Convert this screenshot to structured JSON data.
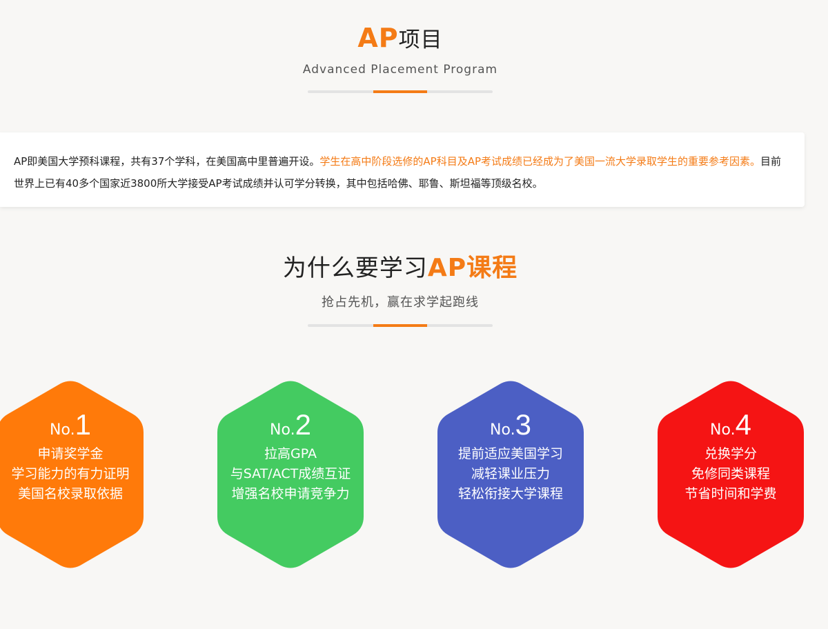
{
  "section1": {
    "title_accent": "AP",
    "title_rest": "项目",
    "subtitle": "Advanced Placement Program"
  },
  "intro": {
    "text_part1": "AP即美国大学预科课程，共有37个学科，在美国高中里普遍开设。",
    "text_highlight": "学生在高中阶段选修的AP科目及AP考试成绩已经成为了美国一流大学录取学生的重要参考因素。",
    "text_part2": "目前世界上已有40多个国家近3800所大学接受AP考试成绩并认可学分转换，其中包括哈佛、耶鲁、斯坦福等顶级名校。"
  },
  "section2": {
    "title_plain": "为什么要学习",
    "title_accent": "AP课程",
    "subtitle": "抢占先机，赢在求学起跑线"
  },
  "colors": {
    "accent": "#f47b16",
    "hex1": "#ff7a0a",
    "hex2": "#44cb61",
    "hex3": "#4c5fc4",
    "hex4": "#f51414"
  },
  "hexagons": [
    {
      "no_prefix": "No.",
      "no": "1",
      "lines": [
        "申请奖学金",
        "学习能力的有力证明",
        "美国名校录取依据"
      ]
    },
    {
      "no_prefix": "No.",
      "no": "2",
      "lines": [
        "拉高GPA",
        "与SAT/ACT成绩互证",
        "增强名校申请竞争力"
      ]
    },
    {
      "no_prefix": "No.",
      "no": "3",
      "lines": [
        "提前适应美国学习",
        "减轻课业压力",
        "轻松衔接大学课程"
      ]
    },
    {
      "no_prefix": "No.",
      "no": "4",
      "lines": [
        "兑换学分",
        "免修同类课程",
        "节省时间和学费"
      ]
    }
  ]
}
